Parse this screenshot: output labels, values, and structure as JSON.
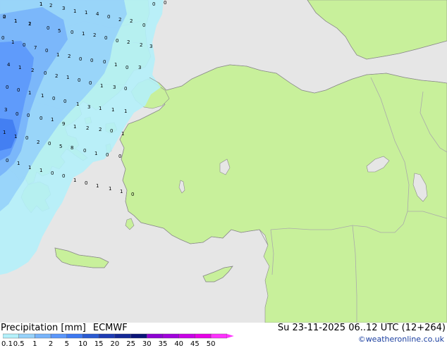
{
  "title": "Precipitation [mm]",
  "model": "ECMWF",
  "datetime": "Su 23-11-2025 06..12 UTC (12+264)",
  "credit": "©weatheronline.co.uk",
  "legend": {
    "labels": [
      "0.1",
      "0.5",
      "1",
      "2",
      "5",
      "10",
      "15",
      "20",
      "25",
      "30",
      "35",
      "40",
      "45",
      "50"
    ],
    "colors": [
      "#b4f0fa",
      "#96d2fa",
      "#78b4fa",
      "#5a96fa",
      "#3c78f0",
      "#2a5ad2",
      "#1e3cb4",
      "#142896",
      "#0a1478",
      "#8c00d2",
      "#a000dc",
      "#c800e6",
      "#e600e6",
      "#ff32ff"
    ]
  },
  "map_colors": {
    "sea": "#e6e6e6",
    "land": "#c8f09b",
    "coast": "#8a8a8a",
    "border": "#aaaaaa"
  },
  "precip_values": [
    "2",
    "1",
    "2",
    "1",
    "2",
    "3",
    "1",
    "1",
    "4",
    "0",
    "2",
    "2",
    "0",
    "0",
    "0",
    "0",
    "5",
    "0",
    "1",
    "2",
    "0",
    "0",
    "2",
    "2",
    "3",
    "0",
    "1",
    "0",
    "7",
    "0",
    "1",
    "2",
    "0",
    "0",
    "0",
    "1",
    "0",
    "3",
    "4",
    "1",
    "2",
    "0",
    "2",
    "1",
    "0",
    "0",
    "1",
    "3",
    "0",
    "0",
    "0",
    "1",
    "1",
    "0",
    "0",
    "1",
    "3",
    "1",
    "1",
    "1",
    "3",
    "0",
    "0",
    "0",
    "1",
    "9",
    "1",
    "2",
    "2",
    "0",
    "1",
    "1",
    "1",
    "0",
    "2",
    "0",
    "5",
    "8",
    "0",
    "1",
    "0",
    "0",
    "0",
    "1",
    "1",
    "1",
    "0",
    "0",
    "1",
    "0",
    "1",
    "1",
    "1",
    "0",
    "0",
    "1",
    "1",
    "1"
  ]
}
